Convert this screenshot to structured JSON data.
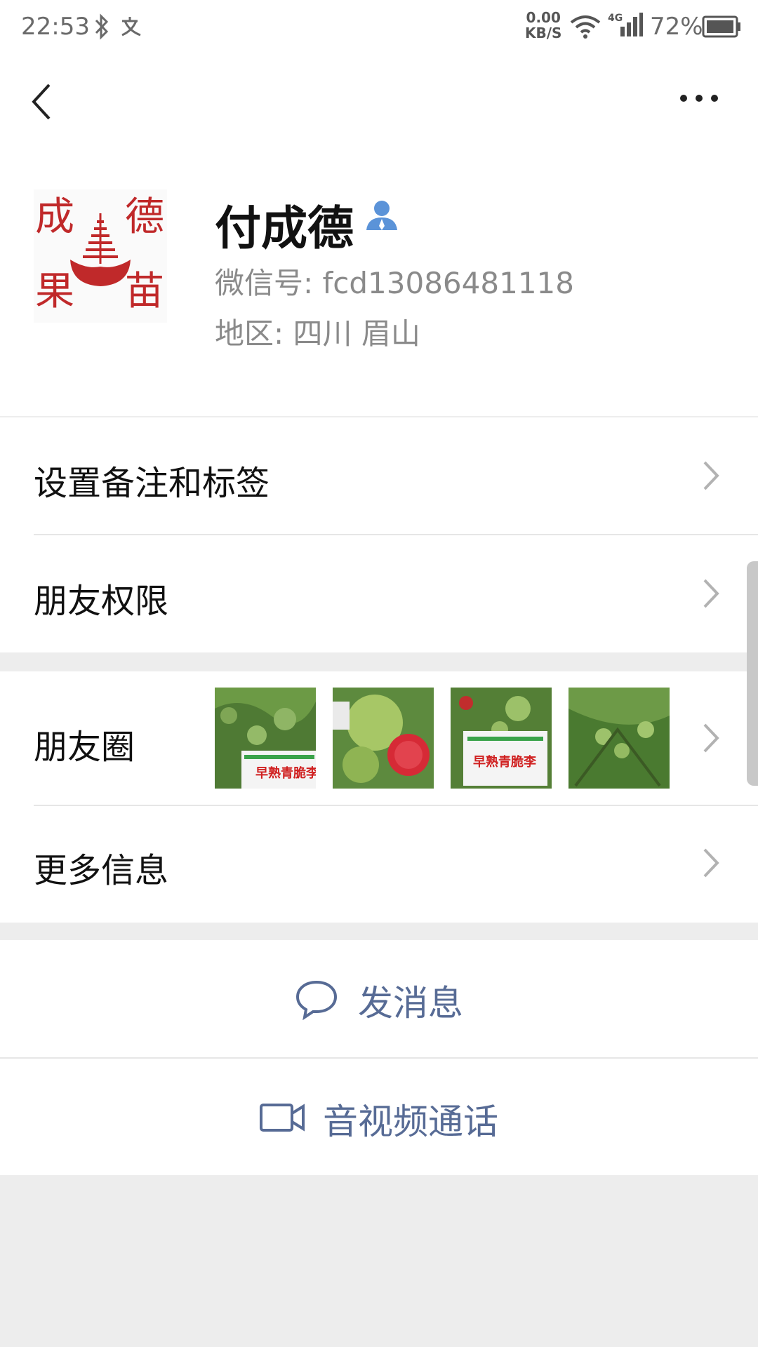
{
  "status_bar": {
    "time": "22:53",
    "net_speed_value": "0.00",
    "net_speed_unit": "KB/S",
    "network": "4G",
    "battery": "72%",
    "icons": [
      "bluetooth-icon",
      "translate-icon",
      "wifi-icon",
      "signal-icon",
      "battery-icon"
    ]
  },
  "nav": {
    "back_icon": "chevron-left-icon",
    "more_icon": "more-dots-icon"
  },
  "profile": {
    "name": "付成德",
    "wechat_id": "微信号: fcd13086481118",
    "region": "地区: 四川 眉山",
    "avatar_logo_chars": [
      "成",
      "德",
      "果",
      "苗"
    ],
    "verify_icon": "person-icon"
  },
  "menu": {
    "remark_tags": "设置备注和标签",
    "permissions": "朋友权限",
    "moments": "朋友圈",
    "more_info": "更多信息"
  },
  "moments_thumbs": [
    {
      "sign_text": "早熟青脆李"
    },
    {
      "sign_text": ""
    },
    {
      "sign_text": "早熟青脆李"
    },
    {
      "sign_text": ""
    }
  ],
  "actions": {
    "message": "发消息",
    "video_call": "音视频通话"
  },
  "colors": {
    "link_blue": "#576b95",
    "logo_red": "#c0292a",
    "background": "#ededed",
    "verify_blue": "#5b93d8"
  }
}
